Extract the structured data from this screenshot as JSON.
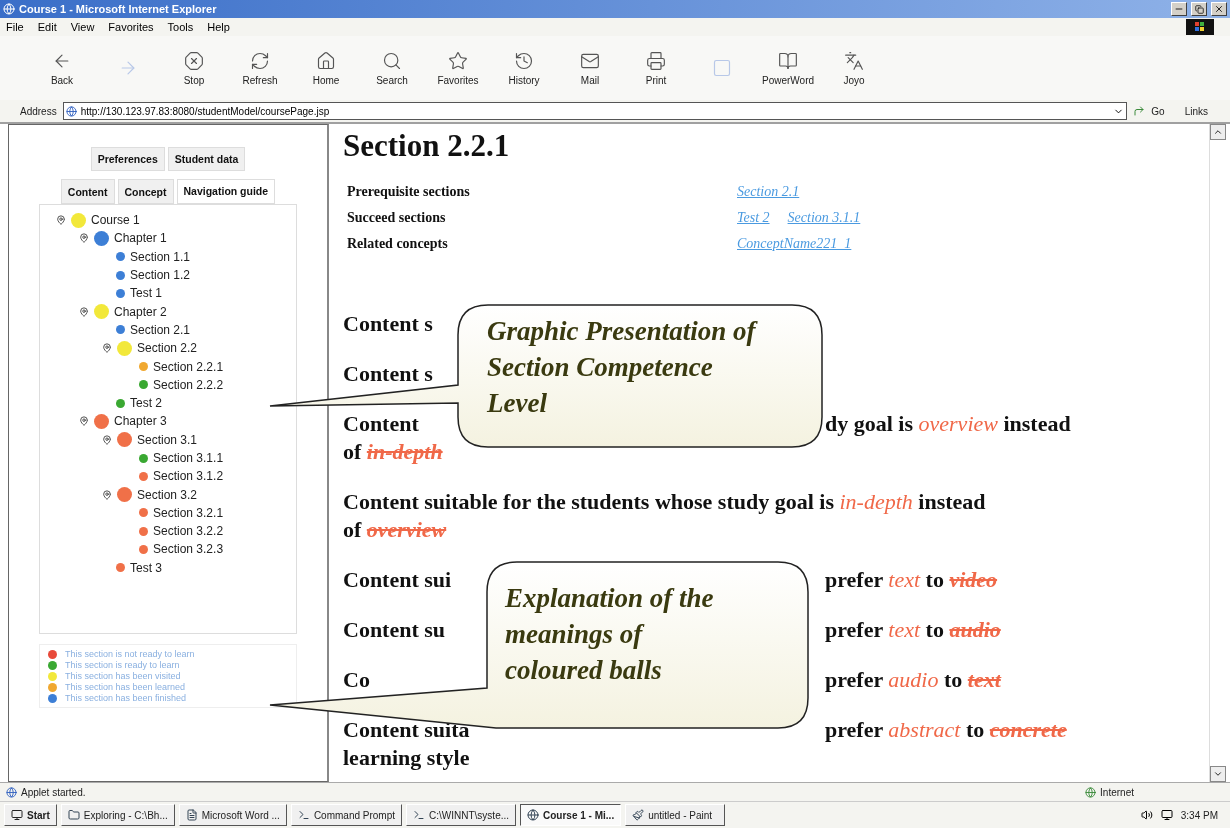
{
  "window": {
    "title": "Course 1 - Microsoft Internet Explorer"
  },
  "menu": [
    "File",
    "Edit",
    "View",
    "Favorites",
    "Tools",
    "Help"
  ],
  "toolbar": [
    {
      "kind": "back",
      "label": "Back",
      "disabled": false
    },
    {
      "kind": "forward",
      "disabled": true
    },
    {
      "kind": "stop",
      "label": "Stop",
      "disabled": false
    },
    {
      "kind": "refresh",
      "label": "Refresh",
      "disabled": false
    },
    {
      "kind": "home",
      "label": "Home",
      "disabled": false
    },
    {
      "kind": "search",
      "label": "Search",
      "disabled": false
    },
    {
      "kind": "favorites",
      "label": "Favorites",
      "disabled": false
    },
    {
      "kind": "history",
      "label": "History",
      "disabled": false
    },
    {
      "kind": "mail",
      "label": "Mail",
      "disabled": false
    },
    {
      "kind": "print",
      "label": "Print",
      "disabled": false
    },
    {
      "kind": "blank",
      "disabled": true
    },
    {
      "kind": "dictionary",
      "label": "PowerWord",
      "disabled": false
    },
    {
      "kind": "translate",
      "label": "Joyo",
      "disabled": false
    }
  ],
  "address": {
    "label": "Address",
    "value": "http://130.123.97.83:8080/studentModel/coursePage.jsp",
    "go": "Go",
    "links": "Links"
  },
  "sidebar": {
    "top_tabs": [
      {
        "label": "Preferences",
        "selected": false
      },
      {
        "label": "Student data",
        "selected": false
      }
    ],
    "tabs": [
      {
        "label": "Content",
        "selected": false
      },
      {
        "label": "Concept",
        "selected": false
      },
      {
        "label": "Navigation guide",
        "selected": true
      }
    ],
    "tree": [
      {
        "label": "Course 1",
        "color": "#f2e83a",
        "children": [
          {
            "label": "Chapter 1",
            "color": "#3d7fd6",
            "children": [
              {
                "label": "Section 1.1",
                "color": "#3d7fd6"
              },
              {
                "label": "Section 1.2",
                "color": "#3d7fd6"
              },
              {
                "label": "Test 1",
                "color": "#3d7fd6"
              }
            ]
          },
          {
            "label": "Chapter 2",
            "color": "#f2e83a",
            "children": [
              {
                "label": "Section 2.1",
                "color": "#3d7fd6"
              },
              {
                "label": "Section 2.2",
                "color": "#f2e83a",
                "children": [
                  {
                    "label": "Section 2.2.1",
                    "color": "#f0a830"
                  },
                  {
                    "label": "Section 2.2.2",
                    "color": "#3aa832"
                  }
                ]
              },
              {
                "label": "Test 2",
                "color": "#3aa832"
              }
            ]
          },
          {
            "label": "Chapter 3",
            "color": "#f07048",
            "children": [
              {
                "label": "Section 3.1",
                "color": "#f07048",
                "children": [
                  {
                    "label": "Section 3.1.1",
                    "color": "#3aa832"
                  },
                  {
                    "label": "Section 3.1.2",
                    "color": "#f07048"
                  }
                ]
              },
              {
                "label": "Section 3.2",
                "color": "#f07048",
                "children": [
                  {
                    "label": "Section 3.2.1",
                    "color": "#f07048"
                  },
                  {
                    "label": "Section 3.2.2",
                    "color": "#f07048"
                  },
                  {
                    "label": "Section 3.2.3",
                    "color": "#f07048"
                  }
                ]
              },
              {
                "label": "Test 3",
                "color": "#f07048"
              }
            ]
          }
        ]
      }
    ],
    "legend": [
      {
        "color": "#e84a3a",
        "text": "This section is not ready to learn"
      },
      {
        "color": "#3aa832",
        "text": "This section is ready to learn"
      },
      {
        "color": "#f2e83a",
        "text": "This section has been visited"
      },
      {
        "color": "#f0a830",
        "text": "This section has been learned"
      },
      {
        "color": "#3d7fd6",
        "text": "This section has been finished"
      }
    ]
  },
  "content": {
    "heading": "Section 2.2.1",
    "info": [
      {
        "label": "Prerequisite sections",
        "links": [
          "Section 2.1"
        ]
      },
      {
        "label": "Succeed sections",
        "links": [
          "Test 2",
          "Section 3.1.1"
        ]
      },
      {
        "label": "Related concepts",
        "links": [
          "ConceptName221_1"
        ]
      }
    ],
    "lines": [
      {
        "lead": [
          {
            "kind": "plain",
            "text": "Content s"
          }
        ]
      },
      {
        "lead": [
          {
            "kind": "plain",
            "text": "Content s"
          }
        ]
      },
      {
        "lead": [
          {
            "kind": "plain",
            "text": "Content"
          }
        ],
        "tail": [
          {
            "kind": "plain",
            "text": "dy goal is "
          },
          {
            "kind": "preferred",
            "text": "overview"
          },
          {
            "kind": "plain",
            "text": " instead"
          }
        ],
        "continuation": [
          {
            "kind": "plain",
            "text": "of "
          },
          {
            "kind": "rejected",
            "text": "in-depth"
          }
        ]
      },
      {
        "lead": [
          {
            "kind": "plain",
            "text": "Content suitable for the students whose study goal is "
          },
          {
            "kind": "preferred",
            "text": "in-depth"
          },
          {
            "kind": "plain",
            "text": " instead"
          }
        ],
        "continuation": [
          {
            "kind": "plain",
            "text": "of "
          },
          {
            "kind": "rejected",
            "text": "overview"
          }
        ]
      },
      {
        "lead": [
          {
            "kind": "plain",
            "text": "Content sui"
          }
        ],
        "tail": [
          {
            "kind": "plain",
            "text": "prefer "
          },
          {
            "kind": "preferred",
            "text": "text"
          },
          {
            "kind": "plain",
            "text": " to "
          },
          {
            "kind": "rejected",
            "text": "video"
          }
        ]
      },
      {
        "lead": [
          {
            "kind": "plain",
            "text": "Content su"
          }
        ],
        "tail": [
          {
            "kind": "plain",
            "text": "prefer "
          },
          {
            "kind": "preferred",
            "text": "text"
          },
          {
            "kind": "plain",
            "text": " to "
          },
          {
            "kind": "rejected",
            "text": "audio"
          }
        ]
      },
      {
        "lead": [
          {
            "kind": "plain",
            "text": "Co"
          }
        ],
        "tail": [
          {
            "kind": "plain",
            "text": "prefer "
          },
          {
            "kind": "preferred",
            "text": "audio"
          },
          {
            "kind": "plain",
            "text": " to "
          },
          {
            "kind": "rejected",
            "text": "text"
          }
        ]
      },
      {
        "lead": [
          {
            "kind": "plain",
            "text": "Content suita"
          }
        ],
        "tail": [
          {
            "kind": "plain",
            "text": "prefer "
          },
          {
            "kind": "preferred",
            "text": "abstract"
          },
          {
            "kind": "plain",
            "text": " to "
          },
          {
            "kind": "rejected",
            "text": "concrete"
          }
        ],
        "continuation": [
          {
            "kind": "plain",
            "text": "learning style"
          }
        ]
      }
    ]
  },
  "callouts": [
    {
      "lines": [
        "Graphic Presentation of",
        "Section Competence",
        "Level"
      ]
    },
    {
      "lines": [
        "Explanation of the",
        "meanings of",
        "coloured balls"
      ]
    }
  ],
  "status_bar": {
    "text": "Applet started.",
    "zone": "Internet"
  },
  "taskbar": {
    "start": "Start",
    "items": [
      {
        "kind": "explorer",
        "label": "Exploring - C:\\Bh...",
        "selected": false
      },
      {
        "kind": "word",
        "label": "Microsoft Word ...",
        "selected": false
      },
      {
        "kind": "terminal",
        "label": "Command Prompt",
        "selected": false
      },
      {
        "kind": "terminal",
        "label": "C:\\WINNT\\syste...",
        "selected": false
      },
      {
        "kind": "browser",
        "label": "Course 1 - Mi...",
        "selected": true
      },
      {
        "kind": "paint",
        "label": "untitled - Paint",
        "selected": false
      }
    ],
    "clock": "3:34 PM"
  }
}
